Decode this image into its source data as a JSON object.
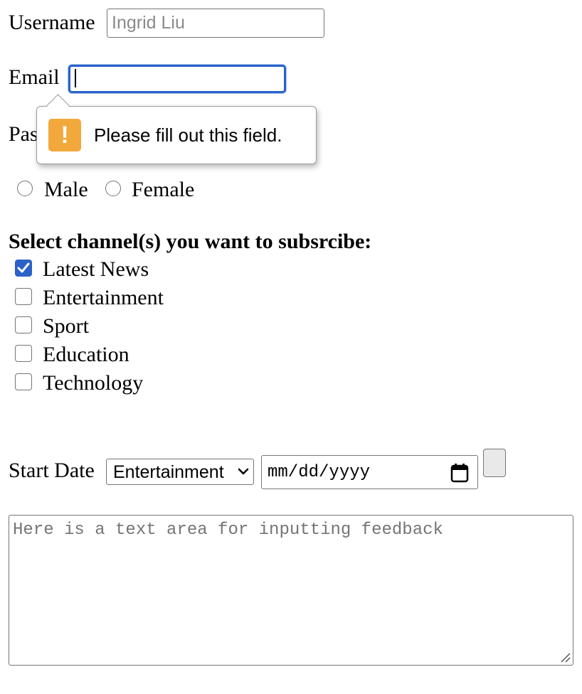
{
  "username": {
    "label": "Username",
    "placeholder": "Ingrid Liu",
    "value": ""
  },
  "email": {
    "label": "Email",
    "value": ""
  },
  "password": {
    "label_visible": "Pas"
  },
  "validation_tooltip": {
    "message": "Please fill out this field.",
    "icon": "warning-icon",
    "icon_glyph": "!",
    "icon_color": "#f2a83a"
  },
  "gender": {
    "options": [
      {
        "label": "Male",
        "checked": false
      },
      {
        "label": "Female",
        "checked": false
      }
    ]
  },
  "channels": {
    "heading": "Select channel(s) you want to subsrcibe:",
    "items": [
      {
        "label": "Latest News",
        "checked": true
      },
      {
        "label": "Entertainment",
        "checked": false
      },
      {
        "label": "Sport",
        "checked": false
      },
      {
        "label": "Education",
        "checked": false
      },
      {
        "label": "Technology",
        "checked": false
      }
    ]
  },
  "start_date": {
    "label": "Start Date",
    "select_value": "Entertainment",
    "date_placeholder": "mm/dd/yyyy",
    "calendar_icon": "calendar-icon"
  },
  "feedback": {
    "placeholder": "Here is a text area for inputting feedback"
  },
  "colors": {
    "focus_ring": "#2a62c9",
    "checkbox_checked": "#2a62c9",
    "warning": "#f2a83a"
  }
}
